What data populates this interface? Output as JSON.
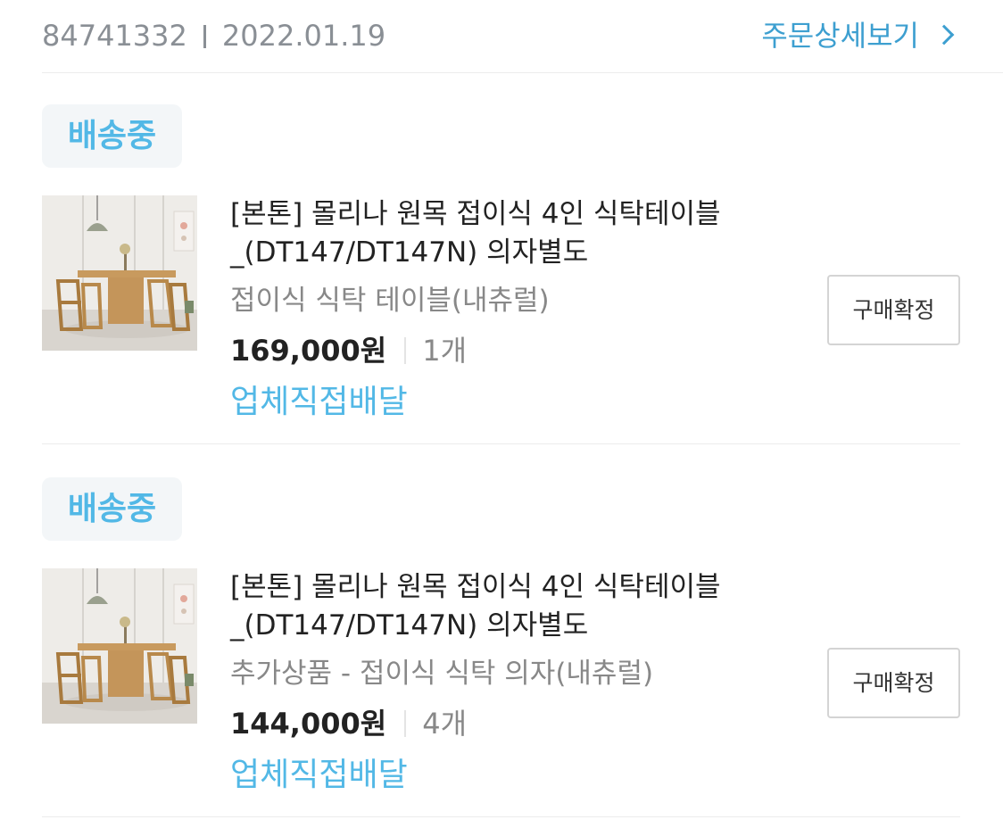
{
  "order": {
    "number": "84741332",
    "date": "2022.01.19",
    "detail_link": "주문상세보기"
  },
  "items": [
    {
      "status": "배송중",
      "title_line1": "[본톤] 몰리나 원목 접이식 4인 식탁테이블",
      "title_line2": "_(DT147/DT147N) 의자별도",
      "option": "접이식 식탁 테이블(내츄럴)",
      "price": "169,000원",
      "quantity": "1개",
      "delivery": "업체직접배달",
      "confirm_label": "구매확정"
    },
    {
      "status": "배송중",
      "title_line1": "[본톤] 몰리나 원목 접이식 4인 식탁테이블",
      "title_line2": "_(DT147/DT147N) 의자별도",
      "option": "추가상품 - 접이식 식탁 의자(내츄럴)",
      "price": "144,000원",
      "quantity": "4개",
      "delivery": "업체직접배달",
      "confirm_label": "구매확정"
    }
  ],
  "colors": {
    "accent_blue": "#3d9fd0",
    "status_blue": "#52b8e6",
    "muted_gray": "#8a8f95"
  }
}
